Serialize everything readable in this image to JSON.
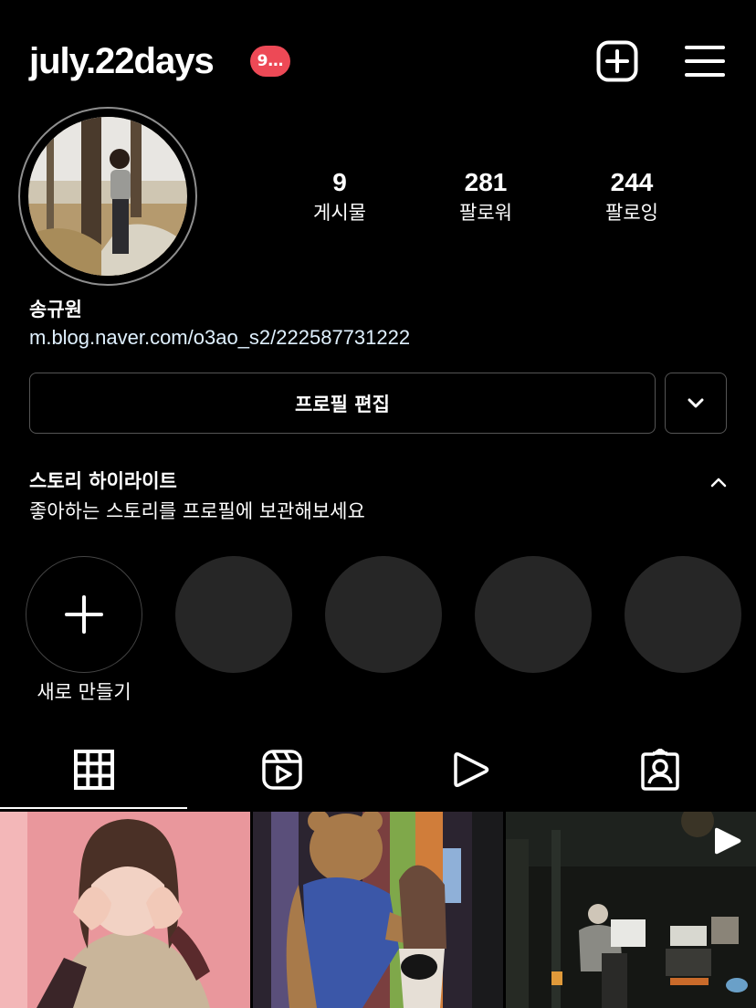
{
  "header": {
    "username": "july.22days",
    "notification_badge": "9…",
    "badge_color": "#ed4956"
  },
  "icons": {
    "create": "plus-square-icon",
    "menu": "hamburger-menu-icon",
    "collapse": "chevron-up-icon",
    "suggest": "chevron-down-icon",
    "new_highlight": "plus-icon",
    "tab_grid": "grid-icon",
    "tab_reels": "reels-icon",
    "tab_videos": "play-icon",
    "tab_tagged": "tagged-person-icon",
    "post_reel_badge": "play-icon"
  },
  "stats": [
    {
      "value": "9",
      "label": "게시물"
    },
    {
      "value": "281",
      "label": "팔로워"
    },
    {
      "value": "244",
      "label": "팔로잉"
    }
  ],
  "profile": {
    "full_name": "송규원",
    "link": "m.blog.naver.com/o3ao_s2/222587731222",
    "edit_button": "프로필 편집"
  },
  "highlights": {
    "title": "스토리 하이라이트",
    "description": "좋아하는 스토리를 프로필에 보관해보세요",
    "new_label": "새로 만들기",
    "placeholder_color": "#262626"
  },
  "tabs": {
    "active": "grid"
  }
}
